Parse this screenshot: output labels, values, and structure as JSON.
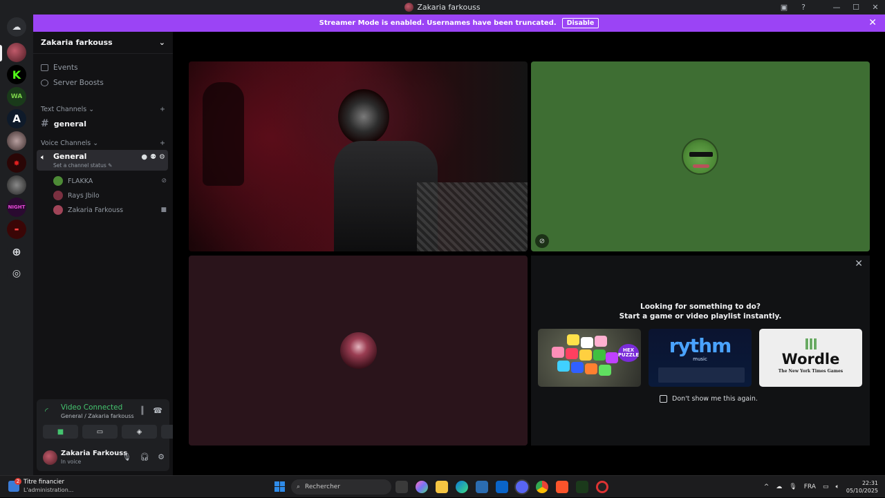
{
  "window": {
    "title": "Zakaria farkouss"
  },
  "banner": {
    "text": "Streamer Mode is enabled. Usernames have been truncated.",
    "button": "Disable"
  },
  "sidebar": {
    "server_name": "Zakaria farkouss",
    "items": [
      {
        "label": "Events",
        "icon": "calendar-icon"
      },
      {
        "label": "Server Boosts",
        "icon": "boost-icon"
      }
    ],
    "text_category": "Text Channels",
    "text_channels": [
      {
        "label": "general"
      }
    ],
    "voice_category": "Voice Channels",
    "voice_channel": {
      "label": "General",
      "status_placeholder": "Set a channel status"
    },
    "members": [
      {
        "name": "FLAKKA",
        "avatar_color": "#4d8a36",
        "state_icon": "mic-muted-icon"
      },
      {
        "name": "Rays Jbilo",
        "avatar_color": "#7a3040",
        "state_icon": ""
      },
      {
        "name": "Zakaria Farkouss",
        "avatar_color": "#a04458",
        "state_icon": "camera-icon"
      }
    ]
  },
  "voice_panel": {
    "status": "Video Connected",
    "location": "General / Zakaria farkouss",
    "user_name": "Zakaria Farkouss",
    "user_status": "In voice"
  },
  "activity": {
    "line1": "Looking for something to do?",
    "line2": "Start a game or video playlist instantly.",
    "cards": [
      {
        "name": "HEX PUZZLE"
      },
      {
        "name": "rythm",
        "sub": "music"
      },
      {
        "name": "Wordle",
        "sub": "The New York Times Games"
      }
    ],
    "dont_show": "Don't show me this again."
  },
  "taskbar": {
    "widget_title": "Titre financier",
    "widget_sub": "L'administration...",
    "widget_badge": "2",
    "search_placeholder": "Rechercher",
    "language": "FRA",
    "time": "22:31",
    "date": "05/10/2025"
  },
  "colors": {
    "accent": "#9b44f5",
    "connected": "#45c46f",
    "tile_green": "#3e6e33",
    "tile_maroon": "#2a141b"
  }
}
